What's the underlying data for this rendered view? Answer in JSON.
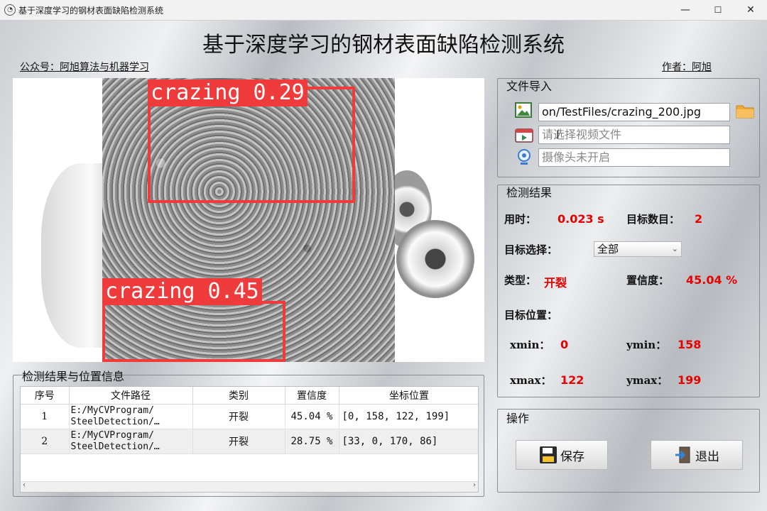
{
  "window": {
    "title": "基于深度学习的钢材表面缺陷检测系统",
    "minimize": "—",
    "maximize": "☐",
    "close": "✕"
  },
  "header": {
    "title": "基于深度学习的钢材表面缺陷检测系统",
    "left_note": "公众号：阿旭算法与机器学习",
    "right_note": "作者：阿旭"
  },
  "detections": [
    {
      "label": "crazing 0.29"
    },
    {
      "label": "crazing 0.45"
    }
  ],
  "file_import": {
    "title": "文件导入",
    "image_path": "on/TestFiles/crazing_200.jpg",
    "video_placeholder": "请选择视频文件",
    "camera_placeholder": "摄像头未开启",
    "icons": [
      "image-icon",
      "video-icon",
      "camera-icon",
      "folder-icon"
    ]
  },
  "results": {
    "title": "检测结果",
    "time_label": "用时：",
    "time_value": "0.023 s",
    "count_label": "目标数目：",
    "count_value": "2",
    "select_label": "目标选择：",
    "select_value": "全部",
    "type_label": "类型：",
    "type_value": "开裂",
    "conf_label": "置信度：",
    "conf_value": "45.04 %",
    "pos_label": "目标位置：",
    "xmin_label": "xmin：",
    "xmin_value": "0",
    "ymin_label": "ymin：",
    "ymin_value": "158",
    "xmax_label": "xmax：",
    "xmax_value": "122",
    "ymax_label": "ymax：",
    "ymax_value": "199"
  },
  "table": {
    "title": "检测结果与位置信息",
    "headers": [
      "序号",
      "文件路径",
      "类别",
      "置信度",
      "坐标位置"
    ],
    "rows": [
      {
        "index": "1",
        "path1": "E:/MyCVProgram/",
        "path2": "SteelDetection/…",
        "cls": "开裂",
        "conf": "45.04 %",
        "coords": "[0, 158, 122, 199]"
      },
      {
        "index": "2",
        "path1": "E:/MyCVProgram/",
        "path2": "SteelDetection/…",
        "cls": "开裂",
        "conf": "28.75 %",
        "coords": "[33, 0, 170, 86]"
      }
    ]
  },
  "operations": {
    "title": "操作",
    "save": "保存",
    "exit": "退出"
  },
  "colors": {
    "accent_red": "#e60000",
    "bbox_red": "#ef3b3b"
  }
}
